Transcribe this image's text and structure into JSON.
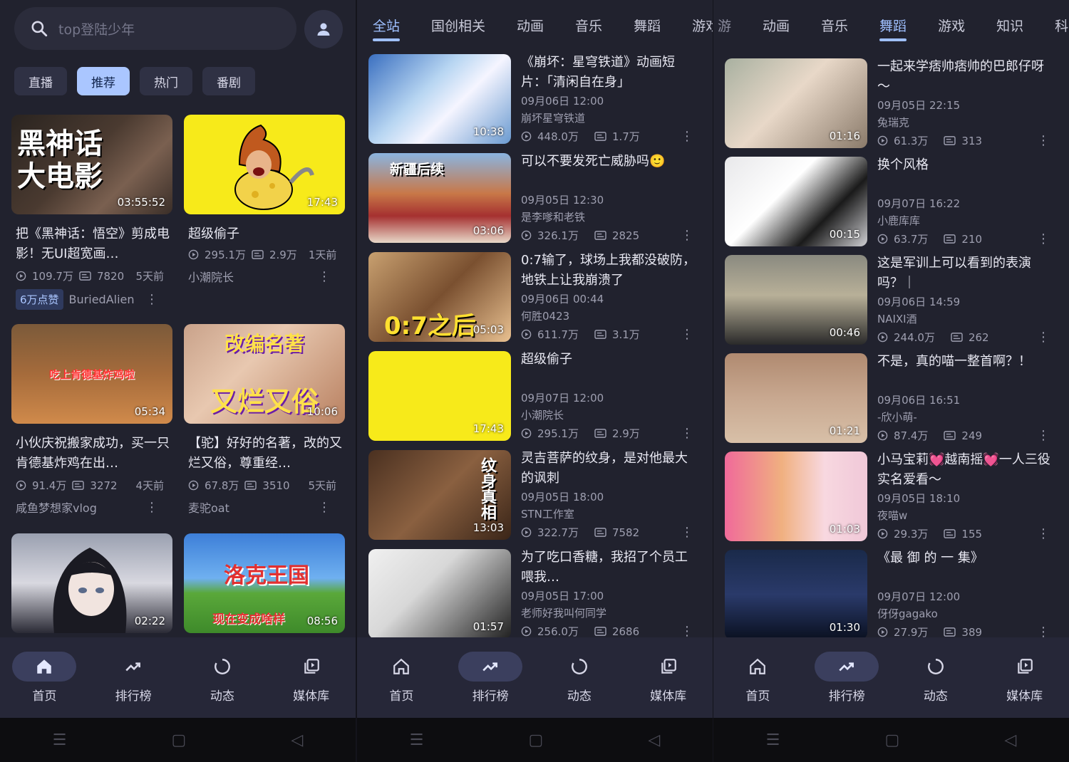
{
  "panel1": {
    "search_placeholder": "top登陆少年",
    "chips": [
      "直播",
      "推荐",
      "热门",
      "番剧"
    ],
    "active_chip": 1,
    "cards": [
      {
        "title": "把《黑神话：悟空》剪成电影！无UI超宽画…",
        "duration": "03:55:52",
        "views": "109.7万",
        "danmaku": "7820",
        "time": "5天前",
        "author": "BuriedAlien",
        "badge": "6万点赞",
        "thumb_text": "黑神话\n大电影"
      },
      {
        "title": "超级偷子",
        "duration": "17:43",
        "views": "295.1万",
        "danmaku": "2.9万",
        "time": "1天前",
        "author": "小潮院长"
      },
      {
        "title": "小伙庆祝搬家成功，买一只肯德基炸鸡在出…",
        "duration": "05:34",
        "views": "91.4万",
        "danmaku": "3272",
        "time": "4天前",
        "author": "咸鱼梦想家vlog",
        "thumb_text": "吃上肯德基炸鸡啦"
      },
      {
        "title": "【驼】好好的名著，改的又烂又俗，尊重经…",
        "duration": "10:06",
        "views": "67.8万",
        "danmaku": "3510",
        "time": "5天前",
        "author": "麦驼oat",
        "thumb_text": "改编名著\n又烂又俗"
      },
      {
        "title": "",
        "duration": "02:22"
      },
      {
        "title": "",
        "duration": "08:56",
        "thumb_text": "洛克王国\n现在变成啥样"
      }
    ]
  },
  "panel2": {
    "tabs": [
      "全站",
      "国创相关",
      "动画",
      "音乐",
      "舞蹈",
      "游戏"
    ],
    "active_tab": 0,
    "rows": [
      {
        "title": "《崩坏：星穹铁道》动画短片：「清闲自在身」",
        "date": "09月06日 12:00",
        "author": "崩坏星穹铁道",
        "views": "448.0万",
        "danmaku": "1.7万",
        "duration": "10:38"
      },
      {
        "title": "可以不要发死亡威胁吗🙂",
        "date": "09月05日 12:30",
        "author": "是李嗲和老铁",
        "views": "326.1万",
        "danmaku": "2825",
        "duration": "03:06",
        "thumb_text": "新疆后续"
      },
      {
        "title": "0:7输了，球场上我都没破防，地铁上让我崩溃了",
        "date": "09月06日 00:44",
        "author": "何胜0423",
        "views": "611.7万",
        "danmaku": "3.1万",
        "duration": "05:03",
        "thumb_text": "0:7之后"
      },
      {
        "title": "超级偷子",
        "date": "09月07日 12:00",
        "author": "小潮院长",
        "views": "295.1万",
        "danmaku": "2.9万",
        "duration": "17:43"
      },
      {
        "title": "灵吉菩萨的纹身，是对他最大的讽刺",
        "date": "09月05日 18:00",
        "author": "STN工作室",
        "views": "322.7万",
        "danmaku": "7582",
        "duration": "13:03",
        "thumb_text": "纹身真相"
      },
      {
        "title": "为了吃口香糖，我招了个员工喂我…",
        "date": "09月05日 17:00",
        "author": "老师好我叫何同学",
        "views": "256.0万",
        "danmaku": "2686",
        "duration": "01:57"
      }
    ]
  },
  "panel3": {
    "tabs": [
      "动画",
      "音乐",
      "舞蹈",
      "游戏",
      "知识",
      "科"
    ],
    "active_tab": 2,
    "rows": [
      {
        "title": "一起来学痞帅痞帅的巴郎仔呀～",
        "date": "09月05日 22:15",
        "author": "兔瑞克",
        "views": "61.3万",
        "danmaku": "313",
        "duration": "01:16"
      },
      {
        "title": "换个风格",
        "date": "09月07日 16:22",
        "author": "小鹿库库",
        "views": "63.7万",
        "danmaku": "210",
        "duration": "00:15"
      },
      {
        "title": "这是军训上可以看到的表演吗？｜",
        "date": "09月06日 14:59",
        "author": "NAIXI酒",
        "views": "244.0万",
        "danmaku": "262",
        "duration": "00:46"
      },
      {
        "title": "不是，真的喵一整首啊？！",
        "date": "09月06日 16:51",
        "author": "-欣小萌-",
        "views": "87.4万",
        "danmaku": "249",
        "duration": "01:21"
      },
      {
        "title": "小马宝莉💓越南摇💓一人三役实名爱看～",
        "date": "09月05日 18:10",
        "author": "夜喵w",
        "views": "29.3万",
        "danmaku": "155",
        "duration": "01:03"
      },
      {
        "title": "《最 御 的 一 集》",
        "date": "09月07日 12:00",
        "author": "伢伢gagako",
        "views": "27.9万",
        "danmaku": "389",
        "duration": "01:30"
      }
    ]
  },
  "bottom_nav": [
    "首页",
    "排行榜",
    "动态",
    "媒体库"
  ],
  "colors": {
    "accent": "#9fc0ff",
    "bg": "#21222e",
    "chip_active": "#aac6ff"
  }
}
